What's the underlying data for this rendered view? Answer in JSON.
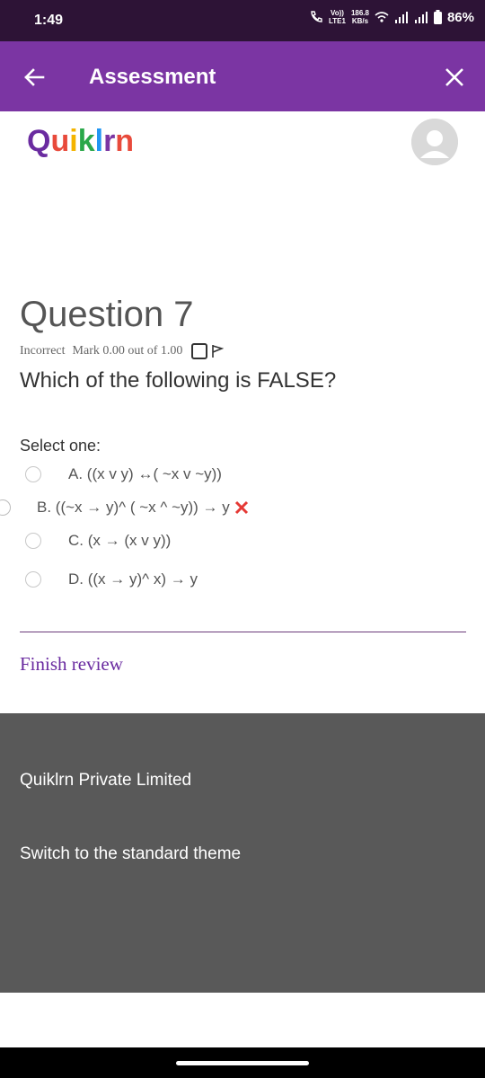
{
  "status_bar": {
    "time": "1:49",
    "volte_top": "Vo))",
    "volte_bottom": "LTE1",
    "speed_top": "186.8",
    "speed_bottom": "KB/s",
    "battery": "86%"
  },
  "app_bar": {
    "title": "Assessment"
  },
  "logo": {
    "text": "Quiklrn",
    "letters": [
      "Q",
      "u",
      "i",
      "k",
      "l",
      "r",
      "n"
    ],
    "colors": [
      "#6a2ba0",
      "#e84a3b",
      "#f4b400",
      "#2aa84a",
      "#2196f3",
      "#7b35a3",
      "#e84a3b"
    ]
  },
  "question": {
    "title": "Question 7",
    "status": "Incorrect",
    "mark": "Mark 0.00 out of 1.00",
    "text": "Which of the following is FALSE?",
    "select_label": "Select one:",
    "options": [
      {
        "label": "A. ((x v y) ↔( ~x v ~y))",
        "selected": false
      },
      {
        "label": "B. ((~x → y)^ ( ~x ^ ~y)) → y",
        "selected": true,
        "incorrect": true
      },
      {
        "label": "C. (x → (x v y))",
        "selected": false
      },
      {
        "label": "D. ((x → y)^ x) → y",
        "selected": false
      }
    ]
  },
  "finish_review": "Finish review",
  "footer": {
    "company": "Quiklrn Private Limited",
    "theme_link": "Switch to the standard theme"
  },
  "colors": {
    "status_bar": "#2d1336",
    "app_bar": "#7b35a3",
    "footer": "#595959",
    "link": "#6a2ba0",
    "incorrect": "#e53935"
  }
}
